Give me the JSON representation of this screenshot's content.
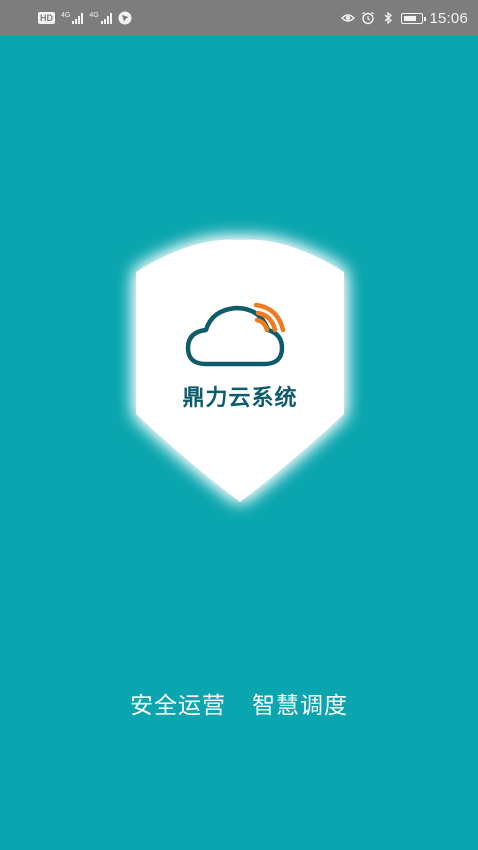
{
  "status_bar": {
    "hd_badge": "HD",
    "network_1": "4G",
    "network_2": "4G",
    "time": "15:06",
    "icons": [
      "hd-icon",
      "signal-icon",
      "signal-icon",
      "navigation-icon",
      "eye-icon",
      "alarm-icon",
      "bluetooth-icon",
      "battery-icon"
    ]
  },
  "splash": {
    "app_name": "鼎力云系统",
    "slogan_left": "安全运营",
    "slogan_right": "智慧调度",
    "colors": {
      "background": "#0aa5ae",
      "shield": "#ffffff",
      "cloud_outline": "#0e5c6b",
      "wifi_arcs": "#f07a1e"
    }
  }
}
